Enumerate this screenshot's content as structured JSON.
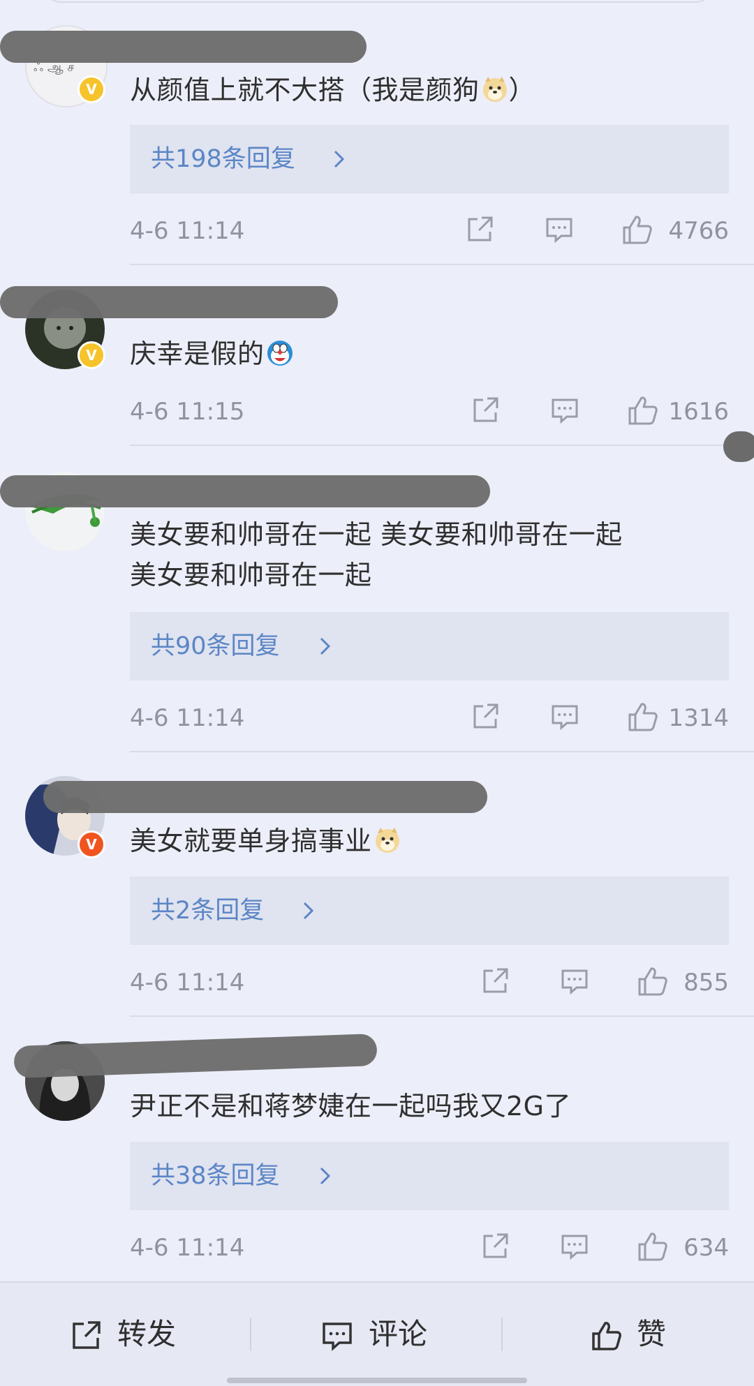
{
  "comments": [
    {
      "text": "从颜值上就不大搭（我是颜狗",
      "text_after": "）",
      "emoji": "doge-emoji",
      "replies": "共198条回复",
      "time": "4-6  11:14",
      "likes": "4766",
      "badge": "yellow"
    },
    {
      "text": "庆幸是假的",
      "text_after": "",
      "emoji": "doraemon-emoji",
      "replies": "",
      "time": "4-6  11:15",
      "likes": "1616",
      "badge": "yellow"
    },
    {
      "text": "美女要和帅哥在一起  美女要和帅哥在一起",
      "text2": "美女要和帅哥在一起",
      "replies": "共90条回复",
      "time": "4-6  11:14",
      "likes": "1314",
      "badge": "none"
    },
    {
      "text": "美女就要单身搞事业",
      "text_after": "",
      "emoji": "doge-emoji",
      "replies": "共2条回复",
      "time": "4-6  11:14",
      "likes": "855",
      "badge": "orange"
    },
    {
      "text": "尹正不是和蒋梦婕在一起吗我又2G了",
      "replies": "共38条回复",
      "time": "4-6  11:14",
      "likes": "634",
      "badge": "none"
    }
  ],
  "badge_letter": "V",
  "bottom_bar": {
    "repost": "转发",
    "comment": "评论",
    "like": "赞"
  },
  "icons": [
    "share-icon",
    "comment-icon",
    "thumbs-up-icon",
    "chevron-right-icon"
  ],
  "colors": {
    "background": "#eceef9",
    "reply_link": "#5b86c6",
    "meta": "#8f92a0",
    "vip_yellow": "#f6c32b",
    "vip_orange": "#f0551f"
  }
}
